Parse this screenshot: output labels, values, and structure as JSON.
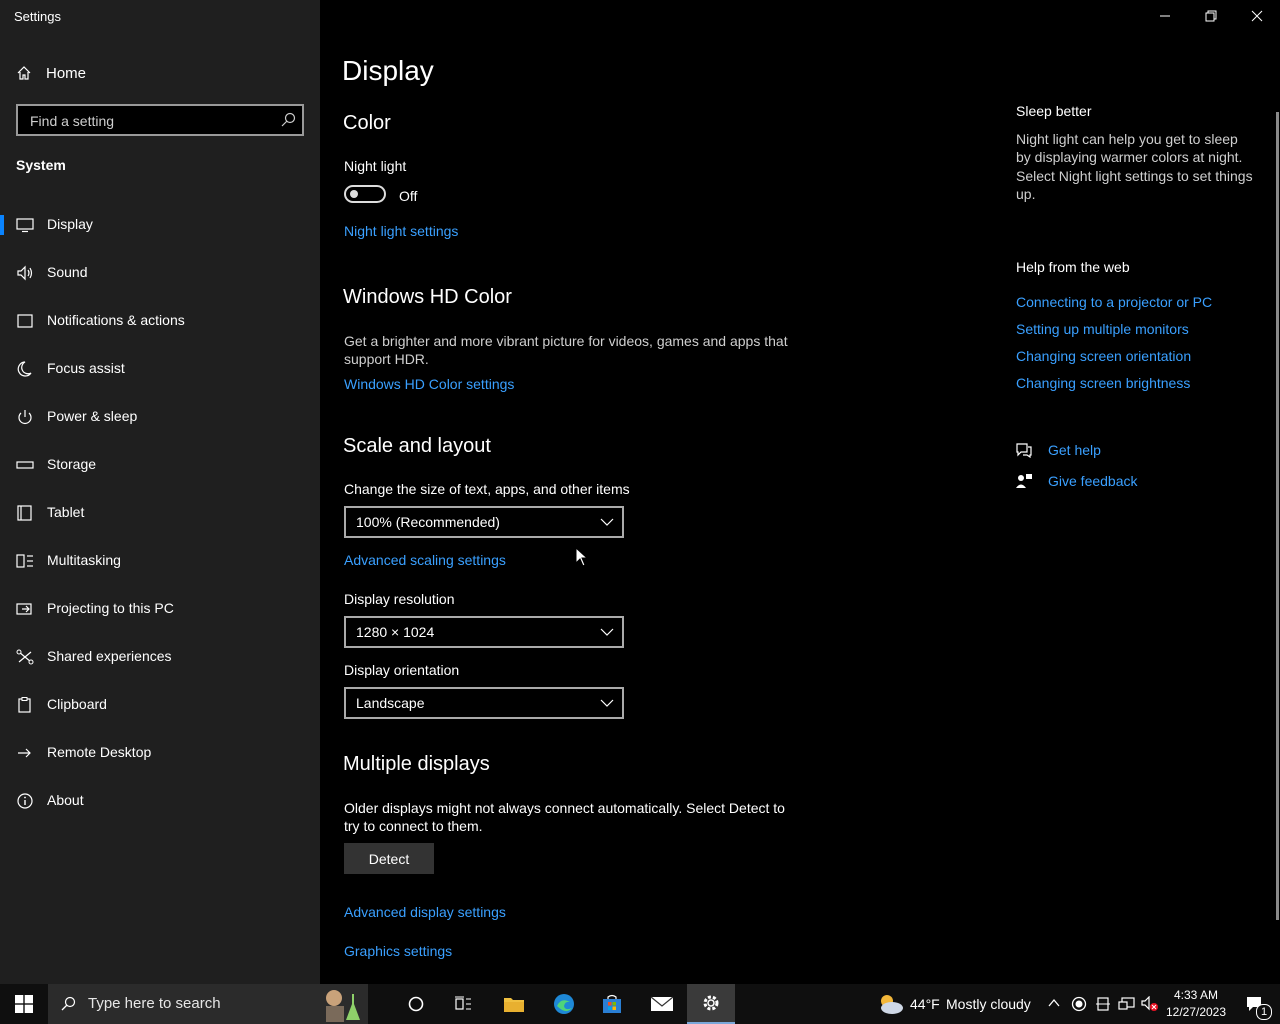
{
  "window": {
    "title": "Settings",
    "controls": [
      "minimize-icon",
      "restore-icon",
      "close-icon"
    ]
  },
  "sidebar": {
    "home_label": "Home",
    "search_placeholder": "Find a setting",
    "section_label": "System",
    "items": [
      {
        "label": "Display",
        "icon": "monitor-icon",
        "selected": true
      },
      {
        "label": "Sound",
        "icon": "speaker-icon"
      },
      {
        "label": "Notifications & actions",
        "icon": "notification-icon"
      },
      {
        "label": "Focus assist",
        "icon": "moon-icon"
      },
      {
        "label": "Power & sleep",
        "icon": "power-icon"
      },
      {
        "label": "Storage",
        "icon": "storage-icon"
      },
      {
        "label": "Tablet",
        "icon": "tablet-icon"
      },
      {
        "label": "Multitasking",
        "icon": "multitasking-icon"
      },
      {
        "label": "Projecting to this PC",
        "icon": "projecting-icon"
      },
      {
        "label": "Shared experiences",
        "icon": "shared-experiences-icon"
      },
      {
        "label": "Clipboard",
        "icon": "clipboard-icon"
      },
      {
        "label": "Remote Desktop",
        "icon": "remote-desktop-icon"
      },
      {
        "label": "About",
        "icon": "info-icon"
      }
    ]
  },
  "main": {
    "title": "Display",
    "color": {
      "heading": "Color",
      "night_light_label": "Night light",
      "toggle_state": "Off",
      "night_light_link": "Night light settings"
    },
    "hdr": {
      "heading": "Windows HD Color",
      "description_line1": "Get a brighter and more vibrant picture for videos, games and apps that",
      "description_line2": "support HDR.",
      "link": "Windows HD Color settings"
    },
    "scale": {
      "heading": "Scale and layout",
      "size_label": "Change the size of text, apps, and other items",
      "size_value": "100% (Recommended)",
      "advanced_link": "Advanced scaling settings",
      "resolution_label": "Display resolution",
      "resolution_value": "1280 × 1024",
      "orientation_label": "Display orientation",
      "orientation_value": "Landscape"
    },
    "multiple": {
      "heading": "Multiple displays",
      "description_line1": "Older displays might not always connect automatically. Select Detect to",
      "description_line2": "try to connect to them.",
      "detect_button": "Detect",
      "advanced_display_link": "Advanced display settings",
      "graphics_link": "Graphics settings"
    }
  },
  "right": {
    "sleep_title": "Sleep better",
    "sleep_lines": [
      "Night light can help you get to sleep",
      "by displaying warmer colors at night.",
      "Select Night light settings to set things",
      "up."
    ],
    "help_title": "Help from the web",
    "help_links": [
      "Connecting to a projector or PC",
      "Setting up multiple monitors",
      "Changing screen orientation",
      "Changing screen brightness"
    ],
    "get_help": "Get help",
    "give_feedback": "Give feedback"
  },
  "taskbar": {
    "search_placeholder": "Type here to search",
    "weather_temp": "44°F",
    "weather_text": "Mostly cloudy",
    "time": "4:33 AM",
    "date": "12/27/2023",
    "notification_count": "1"
  },
  "colors": {
    "accent": "#3aa0ff",
    "sidebar_bg": "#1f1f1f",
    "main_bg": "#000000"
  }
}
